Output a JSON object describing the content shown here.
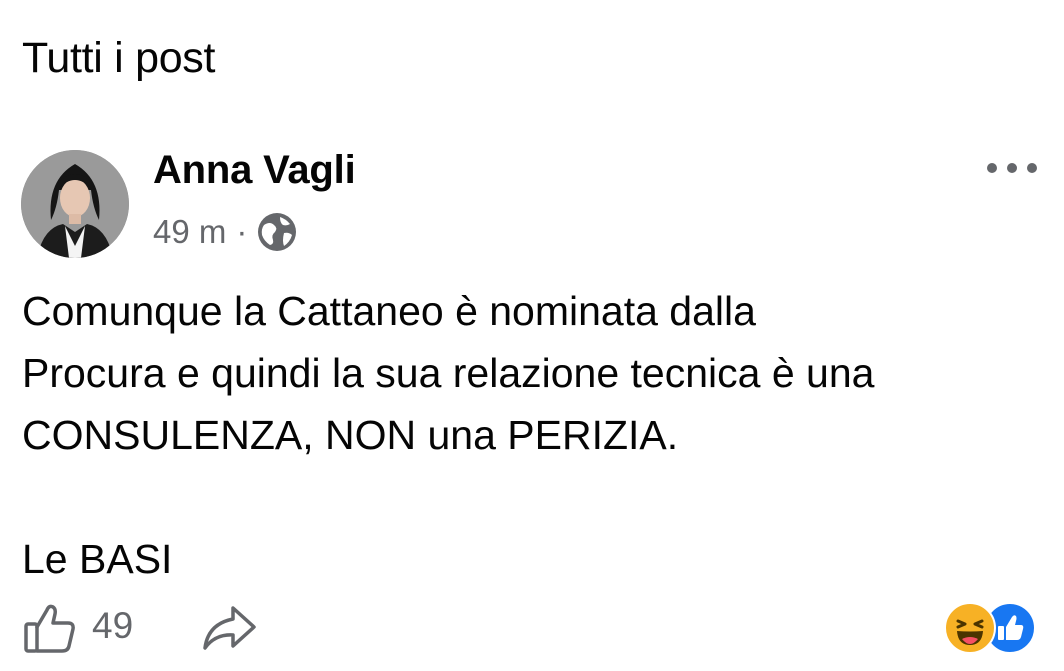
{
  "section": {
    "title": "Tutti i post"
  },
  "post": {
    "author": "Anna Vagli",
    "time": "49 m",
    "separator": "·",
    "privacy_icon": "globe-icon",
    "more_icon": "more-horizontal-icon",
    "body": "Comunque la Cattaneo è nominata dalla\nProcura e quindi la sua relazione tecnica è una\nCONSULENZA, NON una PERIZIA.\n\nLe BASI",
    "like_count": "49",
    "like_icon": "thumbs-up-icon",
    "share_icon": "share-arrow-icon",
    "reactions": [
      "haha-emoji-icon",
      "like-reaction-icon"
    ]
  },
  "colors": {
    "text_primary": "#050505",
    "text_secondary": "#65676b",
    "like_blue": "#1877f2",
    "haha_yellow": "#f7b125"
  }
}
